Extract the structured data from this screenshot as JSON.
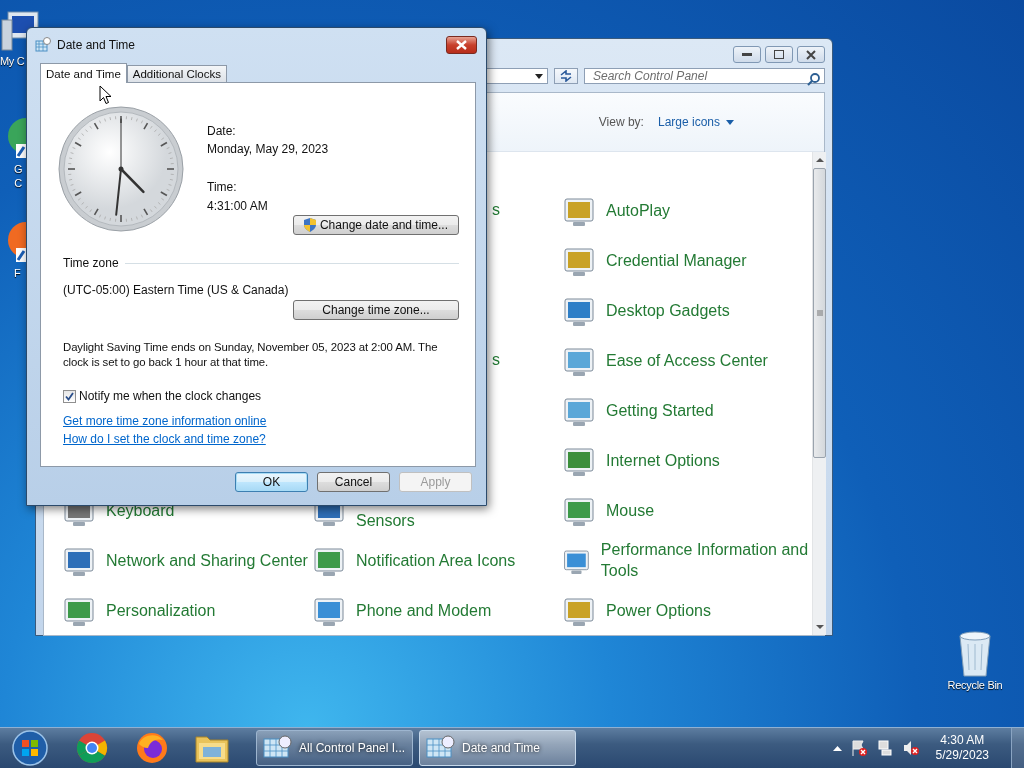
{
  "desktop_icons": [
    {
      "label_lines": [
        "My C"
      ]
    },
    {
      "label_lines": [
        "G",
        "C"
      ]
    },
    {
      "label_lines": [
        "F"
      ]
    }
  ],
  "recycle_bin": {
    "label": "Recycle Bin"
  },
  "control_panel": {
    "search": {
      "placeholder": "Search Control Panel"
    },
    "view_by": {
      "label": "View by:",
      "value": "Large icons"
    },
    "rows": [
      {
        "cells": [
          {
            "kind": "fragment",
            "text": "s"
          },
          {
            "kind": "applet",
            "text": "AutoPlay"
          }
        ]
      },
      {
        "cells": [
          {
            "kind": "applet",
            "text": "Credential Manager"
          }
        ]
      },
      {
        "cells": [
          {
            "kind": "applet",
            "text": "Desktop Gadgets"
          }
        ]
      },
      {
        "cells": [
          {
            "kind": "fragment",
            "text": "s"
          },
          {
            "kind": "applet",
            "text": "Ease of Access Center"
          }
        ]
      },
      {
        "cells": [
          {
            "kind": "applet",
            "text": "Getting Started"
          }
        ]
      },
      {
        "cells": [
          {
            "kind": "applet",
            "text": "Internet Options"
          }
        ]
      },
      {
        "cells": [
          {
            "kind": "applet",
            "text": "Keyboard"
          },
          {
            "kind": "covered",
            "text": "Sensors"
          },
          {
            "kind": "applet",
            "text": "Mouse"
          }
        ]
      },
      {
        "cells": [
          {
            "kind": "applet",
            "text": "Network and Sharing Center"
          },
          {
            "kind": "applet",
            "text": "Notification Area Icons"
          },
          {
            "kind": "applet",
            "text": "Performance Information and Tools"
          }
        ]
      },
      {
        "cells": [
          {
            "kind": "applet",
            "text": "Personalization"
          },
          {
            "kind": "applet",
            "text": "Phone and Modem"
          },
          {
            "kind": "applet",
            "text": "Power Options"
          }
        ]
      }
    ]
  },
  "date_time_dialog": {
    "title": "Date and Time",
    "tabs": [
      {
        "label": "Date and Time",
        "selected": true
      },
      {
        "label": "Additional Clocks",
        "selected": false
      }
    ],
    "date_label": "Date:",
    "date": "Monday, May 29, 2023",
    "time_label": "Time:",
    "time": "4:31:00 AM",
    "change_date_button": "Change date and time...",
    "time_zone_heading": "Time zone",
    "time_zone": "(UTC-05:00) Eastern Time (US & Canada)",
    "change_zone_button": "Change time zone...",
    "dst_note": "Daylight Saving Time ends on Sunday, November 05, 2023 at 2:00 AM. The clock is set to go back 1 hour at that time.",
    "notify": {
      "label": "Notify me when the clock changes",
      "checked": true
    },
    "links": [
      "Get more time zone information online",
      "How do I set the clock and time zone?"
    ],
    "buttons": [
      {
        "label": "OK",
        "default": true,
        "disabled": false
      },
      {
        "label": "Cancel",
        "default": false,
        "disabled": false
      },
      {
        "label": "Apply",
        "default": false,
        "disabled": true
      }
    ]
  },
  "taskbar": {
    "tasks": [
      {
        "label": "All Control Panel I...",
        "selected": false
      },
      {
        "label": "Date and Time",
        "selected": true
      }
    ],
    "clock": {
      "time": "4:30 AM",
      "date": "5/29/2023"
    }
  }
}
